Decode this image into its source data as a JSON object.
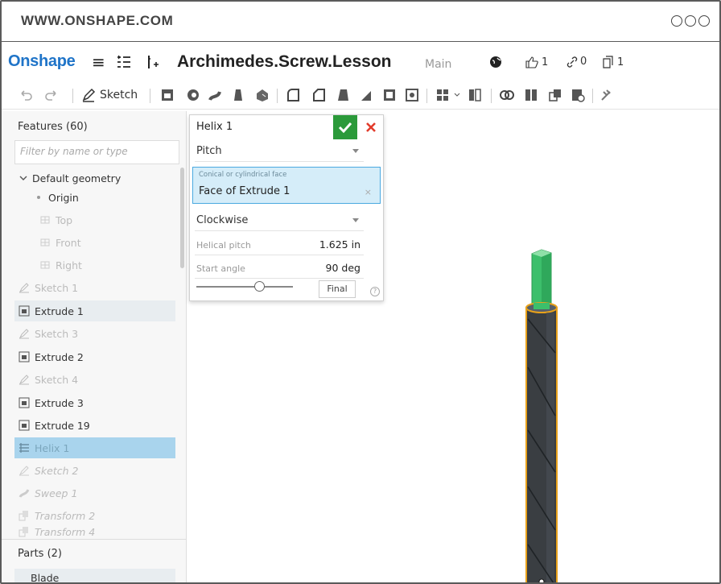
{
  "browser": {
    "url": "WWW.ONSHAPE.COM"
  },
  "app": {
    "logo": "Onshape",
    "document_title": "Archimedes.Screw.Lesson",
    "branch": "Main",
    "likes": "1",
    "links": "0",
    "versions": "1"
  },
  "toolbar": {
    "sketch_label": "Sketch"
  },
  "features": {
    "title": "Features (60)",
    "filter_placeholder": "Filter by name or type",
    "default_geometry": "Default geometry",
    "items": [
      {
        "label": "Origin"
      },
      {
        "label": "Top"
      },
      {
        "label": "Front"
      },
      {
        "label": "Right"
      },
      {
        "label": "Sketch 1"
      },
      {
        "label": "Extrude 1"
      },
      {
        "label": "Sketch 3"
      },
      {
        "label": "Extrude 2"
      },
      {
        "label": "Sketch 4"
      },
      {
        "label": "Extrude 3"
      },
      {
        "label": "Extrude 19"
      },
      {
        "label": "Helix 1"
      },
      {
        "label": "Sketch 2"
      },
      {
        "label": "Sweep 1"
      },
      {
        "label": "Transform 2"
      },
      {
        "label": "Transform 4"
      }
    ]
  },
  "parts": {
    "title": "Parts (2)",
    "items": [
      {
        "label": "Blade"
      }
    ]
  },
  "dialog": {
    "title": "Helix 1",
    "type_value": "Pitch",
    "face_label": "Conical or cylindrical face",
    "face_value": "Face of Extrude 1",
    "direction_value": "Clockwise",
    "helical_pitch_label": "Helical pitch",
    "helical_pitch_value": "1.625 in",
    "start_angle_label": "Start angle",
    "start_angle_value": "90 deg",
    "final_label": "Final",
    "help": "?",
    "slider_position": 0.65
  },
  "colors": {
    "accent_blue": "#1f74c8",
    "ok_green": "#2b9a3a",
    "selection_blue": "#a9d4ed",
    "model_green": "#3cbf6b",
    "model_body": "#3a3e42",
    "outline_orange": "#e8a11a"
  }
}
